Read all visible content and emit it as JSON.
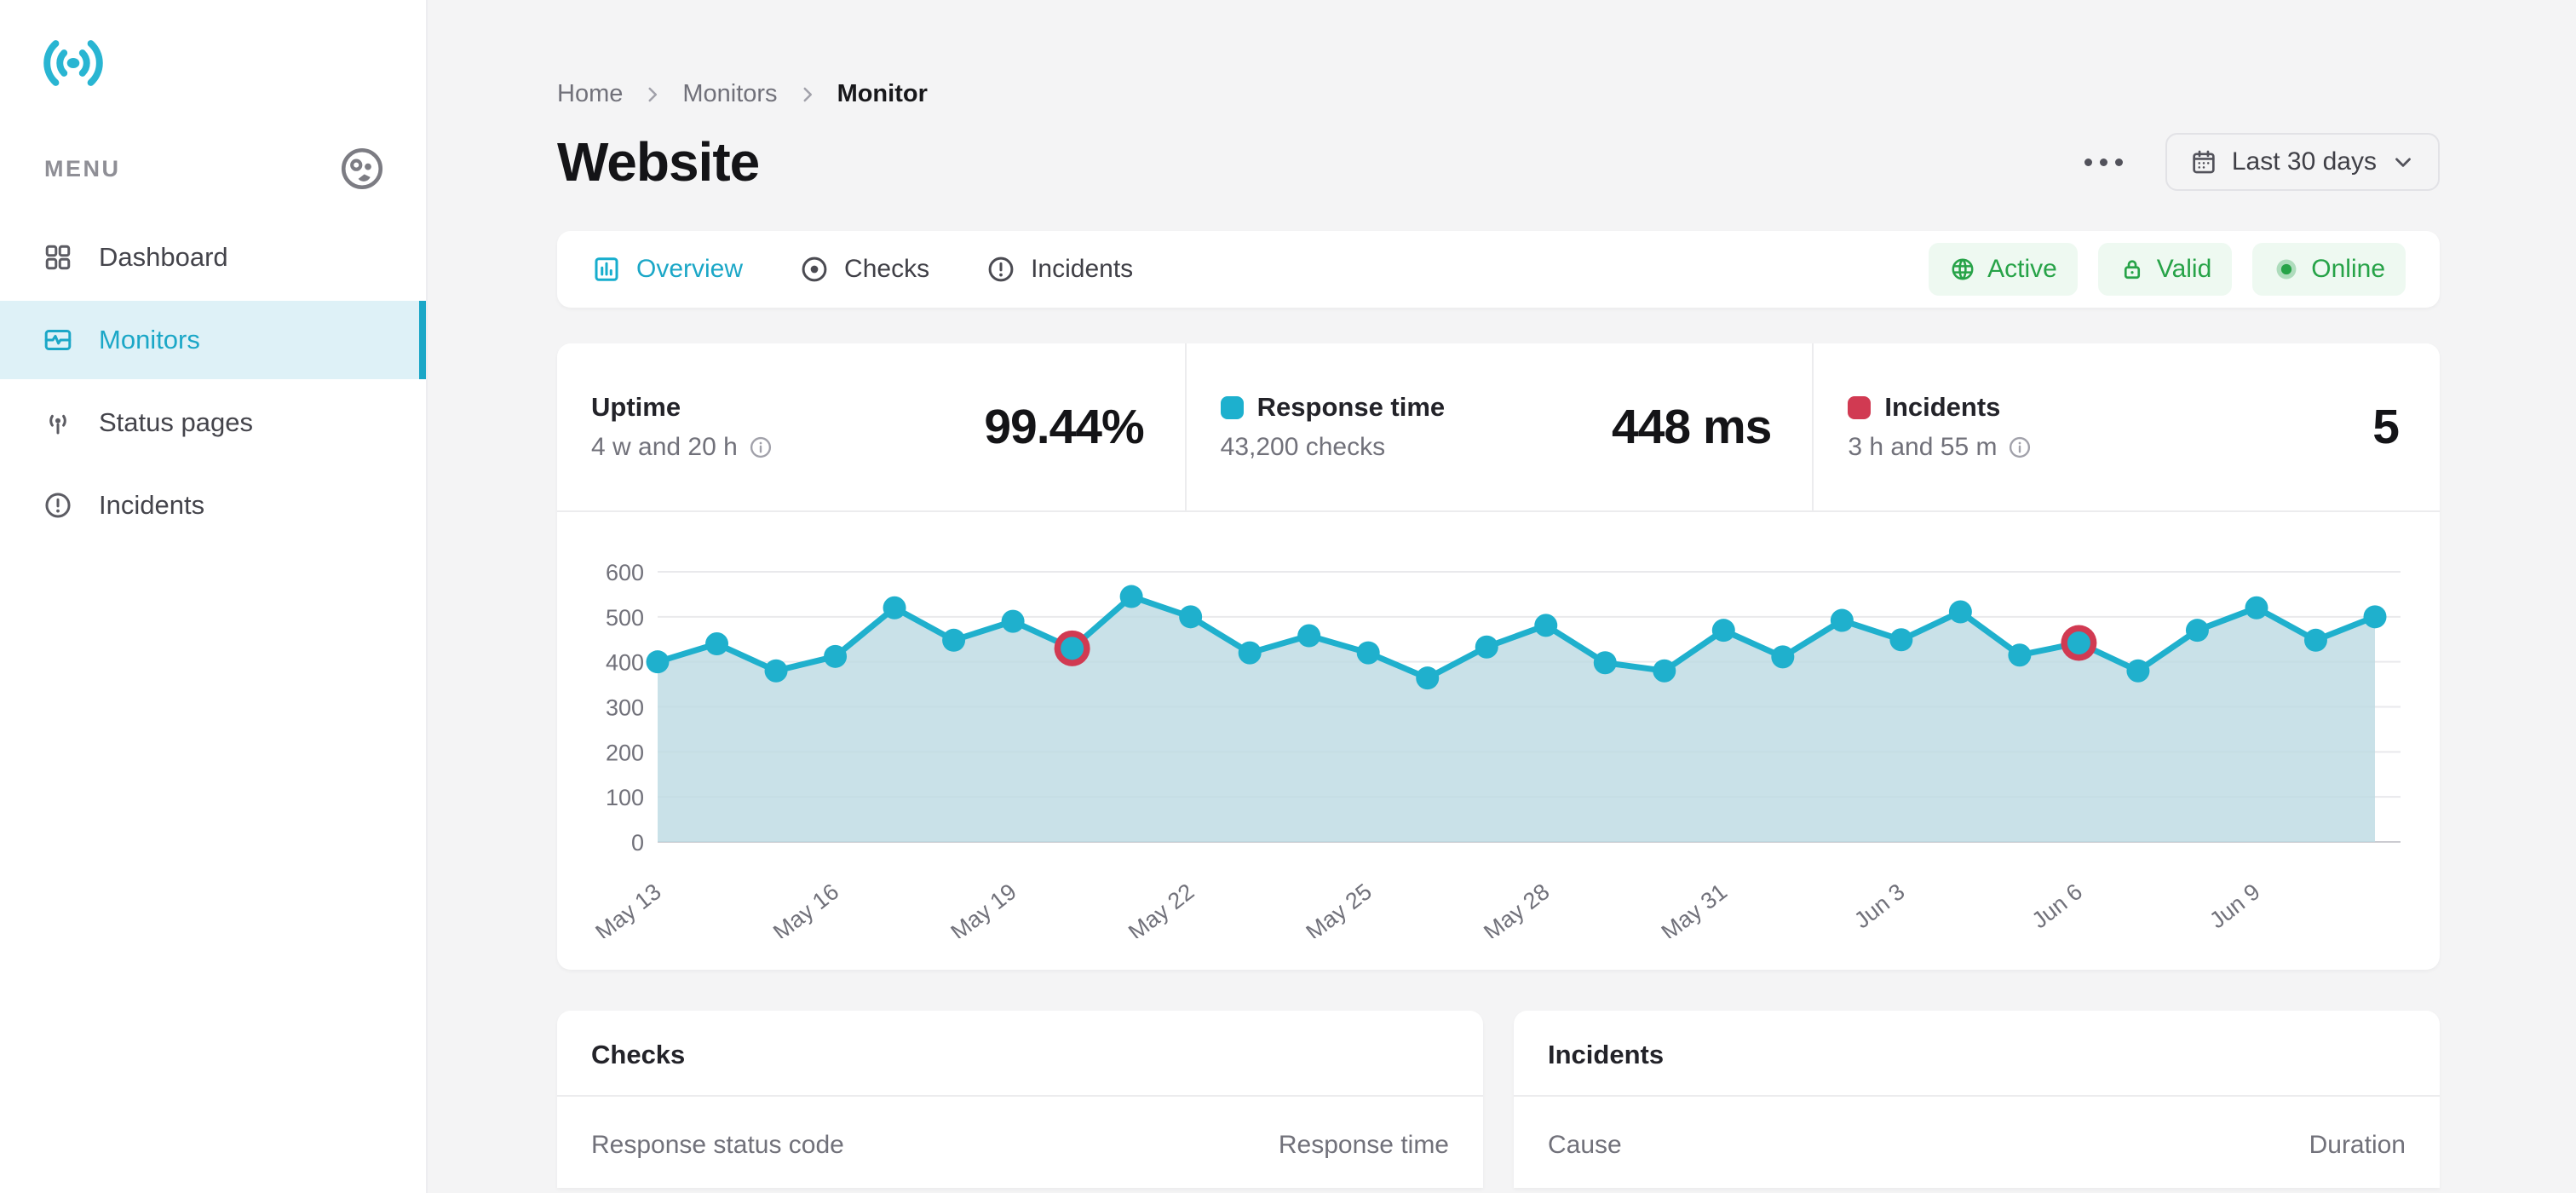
{
  "sidebar": {
    "menu_label": "MENU",
    "items": [
      {
        "label": "Dashboard",
        "icon": "grid-icon",
        "active": false
      },
      {
        "label": "Monitors",
        "icon": "monitor-pulse-icon",
        "active": true
      },
      {
        "label": "Status pages",
        "icon": "broadcast-icon",
        "active": false
      },
      {
        "label": "Incidents",
        "icon": "alert-circle-icon",
        "active": false
      }
    ]
  },
  "breadcrumb": {
    "items": [
      "Home",
      "Monitors",
      "Monitor"
    ]
  },
  "header": {
    "title": "Website",
    "date_range_label": "Last 30 days"
  },
  "tabs": [
    {
      "label": "Overview",
      "active": true
    },
    {
      "label": "Checks",
      "active": false
    },
    {
      "label": "Incidents",
      "active": false
    }
  ],
  "status_badges": [
    {
      "label": "Active",
      "icon": "globe-icon"
    },
    {
      "label": "Valid",
      "icon": "lock-icon"
    },
    {
      "label": "Online",
      "icon": "online-dot-icon"
    }
  ],
  "stats": [
    {
      "label": "Uptime",
      "sub": "4 w and 20 h",
      "value": "99.44%"
    },
    {
      "label": "Response time",
      "sub": "43,200 checks",
      "value": "448 ms"
    },
    {
      "label": "Incidents",
      "sub": "3 h and 55 m",
      "value": "5"
    }
  ],
  "chart_data": {
    "type": "area",
    "x_labels": [
      "May 13",
      "May 16",
      "May 19",
      "May 22",
      "May 25",
      "May 28",
      "May 31",
      "Jun 3",
      "Jun 6",
      "Jun 9"
    ],
    "x_tick_every": 3,
    "values": [
      400,
      440,
      380,
      412,
      520,
      448,
      490,
      430,
      545,
      500,
      420,
      458,
      420,
      364,
      433,
      481,
      398,
      380,
      470,
      411,
      492,
      449,
      511,
      415,
      442,
      380,
      470,
      520,
      448,
      500
    ],
    "incident_indices": [
      7,
      24
    ],
    "ylim": [
      0,
      600
    ],
    "y_ticks": [
      0,
      100,
      200,
      300,
      400,
      500,
      600
    ],
    "grid": true,
    "legend": "none",
    "title": "",
    "xlabel": "",
    "ylabel": ""
  },
  "panels": {
    "checks": {
      "title": "Checks",
      "columns": [
        "Response status code",
        "Response time"
      ]
    },
    "incidents": {
      "title": "Incidents",
      "columns": [
        "Cause",
        "Duration"
      ]
    }
  },
  "colors": {
    "accent": "#1fb0cd",
    "accent_text": "#1ba7c7",
    "area_fill": "#bcd9e2",
    "grid_line": "#e9e9ec",
    "axis_text": "#71717a",
    "zero_line": "#cbcbd1",
    "incident_red": "#d13a52",
    "green": "#27a348",
    "green_bg": "#eef9f1",
    "page_bg": "#f4f4f5"
  }
}
